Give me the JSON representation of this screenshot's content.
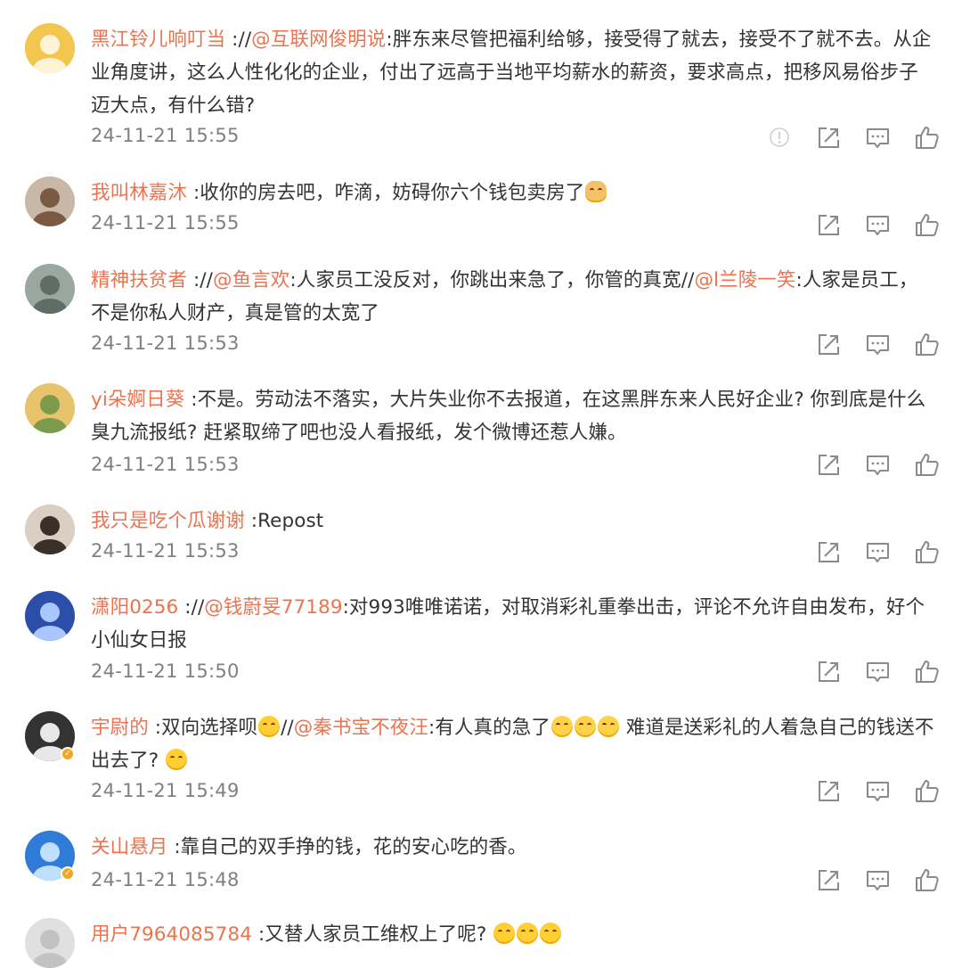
{
  "comments": [
    {
      "user": "黑江铃儿响叮当",
      "segments": [
        {
          "t": " ://",
          "m": false
        },
        {
          "t": "@互联网俊明说",
          "m": true
        },
        {
          "t": ":胖东来尽管把福利给够，接受得了就去，接受不了就不去。从企业角度讲，这么人性化化的企业，付出了远高于当地平均薪水的薪资，要求高点，把移风易俗步子迈大点，有什么错?",
          "m": false
        }
      ],
      "time": "24-11-21 15:55",
      "has_report": true
    },
    {
      "user": "我叫林嘉沐",
      "segments": [
        {
          "t": " :收你的房去吧，咋滴，妨碍你六个钱包卖房了",
          "m": false
        }
      ],
      "emoji_after": [
        "dog"
      ],
      "time": "24-11-21 15:55"
    },
    {
      "user": "精神扶贫者",
      "segments": [
        {
          "t": " ://",
          "m": false
        },
        {
          "t": "@鱼言欢",
          "m": true
        },
        {
          "t": ":人家员工没反对，你跳出来急了，你管的真宽//",
          "m": false
        },
        {
          "t": "@l兰陵一笑",
          "m": true
        },
        {
          "t": ":人家是员工，不是你私人财产，真是管的太宽了",
          "m": false
        }
      ],
      "time": "24-11-21 15:53"
    },
    {
      "user": "yi朵婀日葵",
      "segments": [
        {
          "t": " :不是。劳动法不落实，大片失业你不去报道，在这黑胖东来人民好企业? 你到底是什么臭九流报纸? 赶紧取缔了吧也没人看报纸，发个微博还惹人嫌。",
          "m": false
        }
      ],
      "time": "24-11-21 15:53"
    },
    {
      "user": "我只是吃个瓜谢谢",
      "segments": [
        {
          "t": " :Repost",
          "m": false
        }
      ],
      "time": "24-11-21 15:53"
    },
    {
      "user": "潇阳0256",
      "segments": [
        {
          "t": " ://",
          "m": false
        },
        {
          "t": "@钱蔚旻77189",
          "m": true
        },
        {
          "t": ":对993唯唯诺诺，对取消彩礼重拳出击，评论不允许自由发布，好个小仙女日报",
          "m": false
        }
      ],
      "time": "24-11-21 15:50"
    },
    {
      "user": "宇尉的",
      "verified": true,
      "segments": [
        {
          "t": " :双向选择呗",
          "m": false
        },
        {
          "emoji": "smirk"
        },
        {
          "t": "//",
          "m": false
        },
        {
          "t": "@秦书宝不夜汪",
          "m": true
        },
        {
          "t": ":有人真的急了",
          "m": false
        },
        {
          "emoji": "cry"
        },
        {
          "emoji": "cry"
        },
        {
          "emoji": "cry"
        },
        {
          "t": " 难道是送彩礼的人着急自己的钱送不出去了? ",
          "m": false
        },
        {
          "emoji": "hot"
        }
      ],
      "time": "24-11-21 15:49"
    },
    {
      "user": "关山悬月",
      "verified": true,
      "segments": [
        {
          "t": " :靠自己的双手挣的钱，花的安心吃的香。",
          "m": false
        }
      ],
      "time": "24-11-21 15:48"
    },
    {
      "user": "用户7964085784",
      "segments": [
        {
          "t": " :又替人家员工维权上了呢? ",
          "m": false
        },
        {
          "emoji": "smile"
        },
        {
          "emoji": "smile"
        },
        {
          "emoji": "smile"
        }
      ],
      "time": ""
    }
  ],
  "icons": {
    "report": "report-icon",
    "repost": "repost-icon",
    "comment": "comment-icon",
    "like": "like-icon"
  },
  "colors": {
    "username": "#eb7350",
    "mention": "#eb7350",
    "text": "#333333",
    "time": "#808080",
    "icon": "#8a8a8a"
  }
}
